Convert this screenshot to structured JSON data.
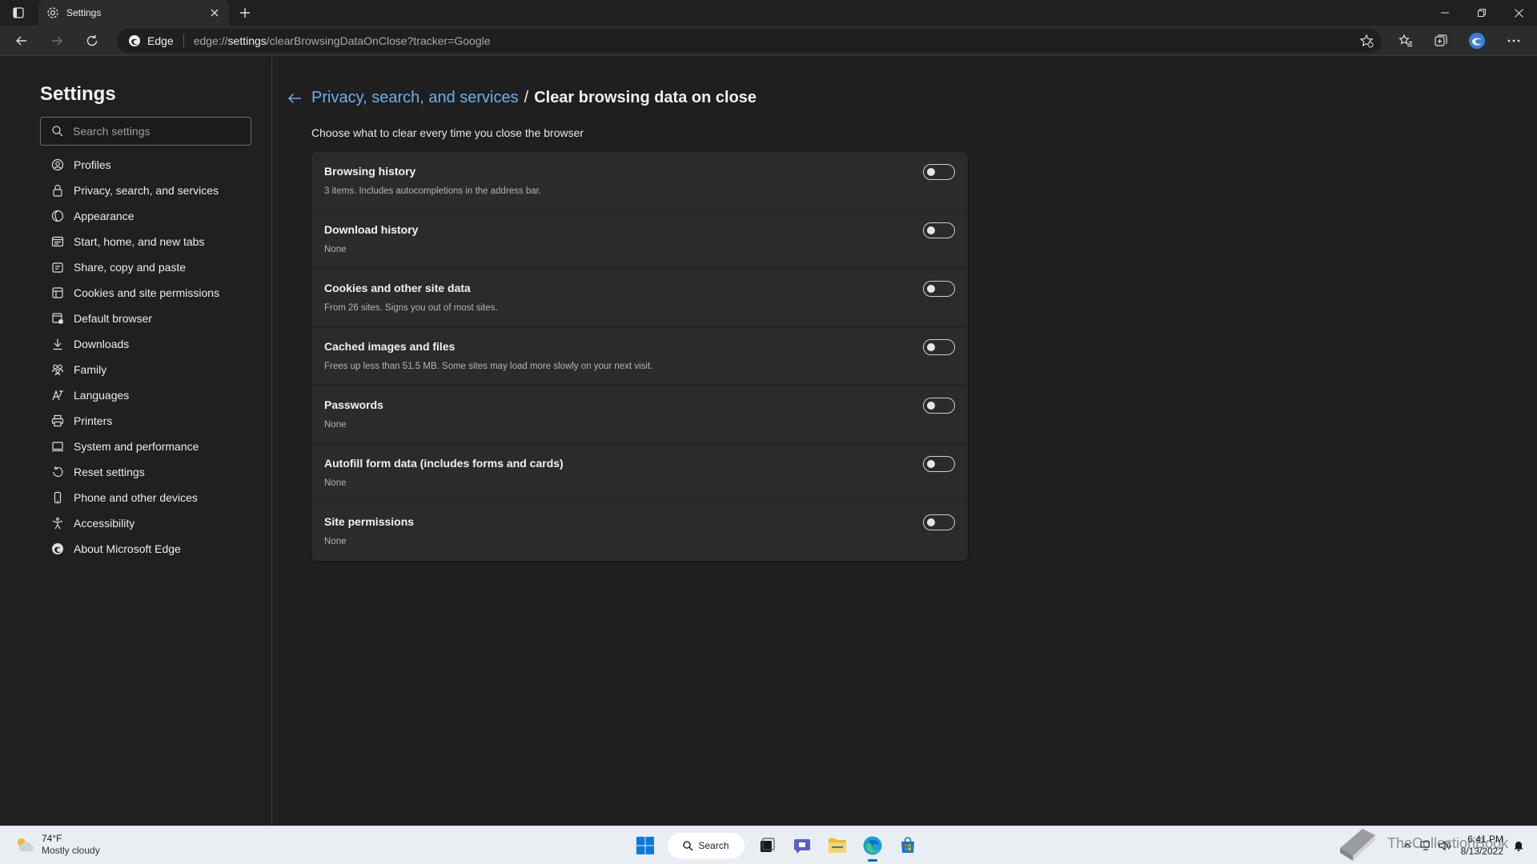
{
  "browser": {
    "tab_title": "Settings",
    "site_name": "Edge",
    "url_prefix": "edge://",
    "url_host": "settings",
    "url_path": "/clearBrowsingDataOnClose?tracker=Google"
  },
  "sidebar": {
    "title": "Settings",
    "search_placeholder": "Search settings",
    "items": [
      {
        "label": "Profiles",
        "icon": "profile-icon"
      },
      {
        "label": "Privacy, search, and services",
        "icon": "lock-icon"
      },
      {
        "label": "Appearance",
        "icon": "appearance-icon"
      },
      {
        "label": "Start, home, and new tabs",
        "icon": "start-icon"
      },
      {
        "label": "Share, copy and paste",
        "icon": "share-icon"
      },
      {
        "label": "Cookies and site permissions",
        "icon": "cookies-icon"
      },
      {
        "label": "Default browser",
        "icon": "default-browser-icon"
      },
      {
        "label": "Downloads",
        "icon": "download-icon"
      },
      {
        "label": "Family",
        "icon": "family-icon"
      },
      {
        "label": "Languages",
        "icon": "languages-icon"
      },
      {
        "label": "Printers",
        "icon": "printer-icon"
      },
      {
        "label": "System and performance",
        "icon": "system-icon"
      },
      {
        "label": "Reset settings",
        "icon": "reset-icon"
      },
      {
        "label": "Phone and other devices",
        "icon": "phone-icon"
      },
      {
        "label": "Accessibility",
        "icon": "accessibility-icon"
      },
      {
        "label": "About Microsoft Edge",
        "icon": "edge-icon"
      }
    ]
  },
  "main": {
    "breadcrumb_parent": "Privacy, search, and services",
    "breadcrumb_sep": "/",
    "breadcrumb_current": "Clear browsing data on close",
    "subtitle": "Choose what to clear every time you close the browser",
    "rows": [
      {
        "title": "Browsing history",
        "desc": "3 items. Includes autocompletions in the address bar.",
        "enabled": false
      },
      {
        "title": "Download history",
        "desc": "None",
        "enabled": false
      },
      {
        "title": "Cookies and other site data",
        "desc": "From 26 sites. Signs you out of most sites.",
        "enabled": false
      },
      {
        "title": "Cached images and files",
        "desc": "Frees up less than 51.5 MB. Some sites may load more slowly on your next visit.",
        "enabled": false
      },
      {
        "title": "Passwords",
        "desc": "None",
        "enabled": false
      },
      {
        "title": "Autofill form data (includes forms and cards)",
        "desc": "None",
        "enabled": false
      },
      {
        "title": "Site permissions",
        "desc": "None",
        "enabled": false
      }
    ]
  },
  "taskbar": {
    "weather_temp": "74°F",
    "weather_condition": "Mostly cloudy",
    "search_label": "Search",
    "time": "6:41 PM",
    "date": "8/13/2022",
    "watermark_text": "TheCollectionBook"
  },
  "colors": {
    "link_blue": "#6cb0f0",
    "background": "#1f1f1f",
    "card": "#2b2b2b"
  }
}
